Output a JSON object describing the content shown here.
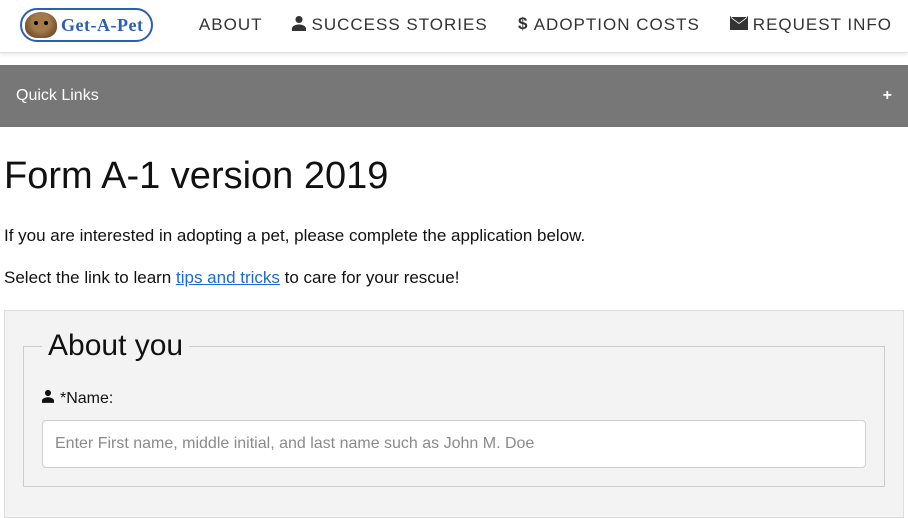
{
  "brand": {
    "text": "Get-A-Pet"
  },
  "nav": {
    "about": "ABOUT",
    "success": "SUCCESS STORIES",
    "costs": "ADOPTION COSTS",
    "request": "REQUEST INFO"
  },
  "quicklinks": {
    "label": "Quick Links"
  },
  "page": {
    "title": "Form A-1 version 2019",
    "intro1": "If you are interested in adopting a pet, please complete the application below.",
    "intro2_pre": "Select the link to learn ",
    "intro2_link": "tips and tricks",
    "intro2_post": " to care for your rescue!"
  },
  "form": {
    "legend": "About you",
    "name_label": "*Name:",
    "name_placeholder": "Enter First name, middle initial, and last name such as John M. Doe",
    "name_value": ""
  }
}
